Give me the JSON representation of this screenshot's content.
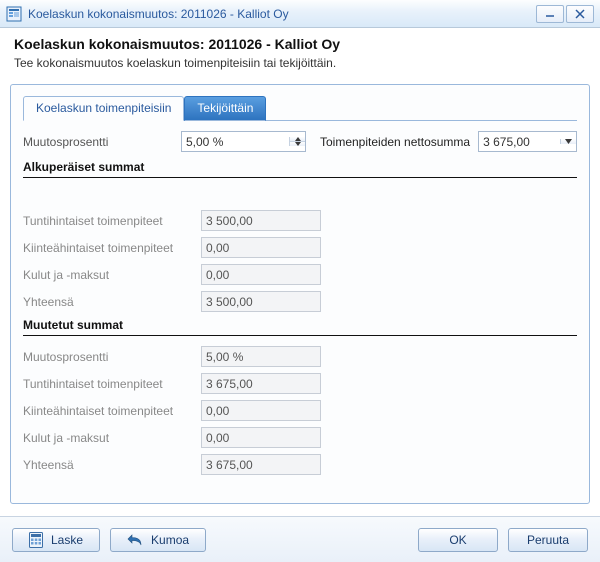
{
  "window": {
    "title": "Koelaskun kokonaismuutos: 2011026 - Kalliot Oy"
  },
  "header": {
    "title": "Koelaskun kokonaismuutos: 2011026 - Kalliot Oy",
    "subtitle": "Tee kokonaismuutos koelaskun toimenpiteisiin tai tekijöittäin."
  },
  "tabs": {
    "active": "Koelaskun toimenpiteisiin",
    "inactive": "Tekijöittäin"
  },
  "top": {
    "percent_label": "Muutosprosentti",
    "percent_value": "5,00 %",
    "netsum_label": "Toimenpiteiden nettosumma",
    "netsum_value": "3 675,00"
  },
  "orig": {
    "heading": "Alkuperäiset summat",
    "hourly_label": "Tuntihintaiset toimenpiteet",
    "hourly_value": "3 500,00",
    "fixed_label": "Kiinteähintaiset toimenpiteet",
    "fixed_value": "0,00",
    "costs_label": "Kulut ja -maksut",
    "costs_value": "0,00",
    "total_label": "Yhteensä",
    "total_value": "3 500,00"
  },
  "changed": {
    "heading": "Muutetut summat",
    "percent_label": "Muutosprosentti",
    "percent_value": "5,00 %",
    "hourly_label": "Tuntihintaiset toimenpiteet",
    "hourly_value": "3 675,00",
    "fixed_label": "Kiinteähintaiset toimenpiteet",
    "fixed_value": "0,00",
    "costs_label": "Kulut ja -maksut",
    "costs_value": "0,00",
    "total_label": "Yhteensä",
    "total_value": "3 675,00"
  },
  "buttons": {
    "calc": "Laske",
    "undo": "Kumoa",
    "ok": "OK",
    "cancel": "Peruuta"
  }
}
